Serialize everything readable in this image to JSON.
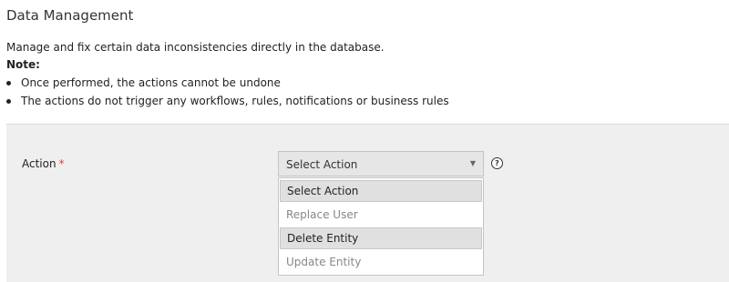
{
  "page": {
    "title": "Data Management",
    "description": "Manage and fix certain data inconsistencies directly in the database.",
    "note_label": "Note:",
    "notes": [
      "Once performed, the actions cannot be undone",
      "The actions do not trigger any workflows, rules, notifications or business rules"
    ]
  },
  "form": {
    "action_label": "Action",
    "required_marker": "*",
    "selected_value": "Select Action",
    "dropdown_arrow": "▼",
    "help_icon": "question-circle-icon",
    "help_glyph": "?",
    "options": [
      {
        "label": "Select Action",
        "state": "selected"
      },
      {
        "label": "Replace User",
        "state": "disabled"
      },
      {
        "label": "Delete Entity",
        "state": "hovered"
      },
      {
        "label": "Update Entity",
        "state": "disabled"
      }
    ]
  },
  "colors": {
    "panel_background": "#efefef",
    "required_star": "#e04040",
    "disabled_option_text": "#888888",
    "highlight_option": "#e0e0e0"
  }
}
